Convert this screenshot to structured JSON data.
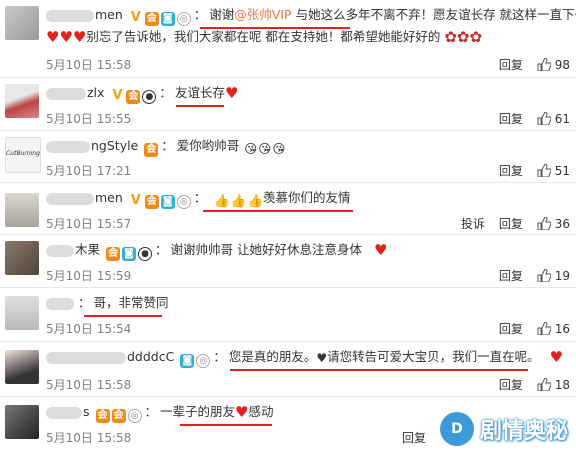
{
  "comments": [
    {
      "user": "men",
      "parts": [
        "谢谢",
        "@张帅VIP",
        " 与她这么多年不离不弃！愿友谊长存 就这样一直下去"
      ],
      "line2": "别忘了告诉她，我们大家都在呢 都在支持她！都希望她能好好的",
      "date": "5月10日 15:58",
      "reply": "回复",
      "likes": "98"
    },
    {
      "user": "zlx",
      "text": "友谊长存",
      "date": "5月10日 15:55",
      "reply": "回复",
      "likes": "61"
    },
    {
      "user": "ngStyle",
      "text": "爱你哟帅哥",
      "date": "5月10日 17:21",
      "reply": "回复",
      "likes": "51"
    },
    {
      "user": "men",
      "text": "羡慕你们的友情",
      "date": "5月10日 15:57",
      "report": "投诉",
      "reply": "回复",
      "likes": "36"
    },
    {
      "user": "木果",
      "text": "谢谢帅帅哥   让她好好休息注意身体",
      "date": "5月10日 15:59",
      "reply": "回复",
      "likes": "19"
    },
    {
      "user": "",
      "text": "哥，非常赞同",
      "date": "5月10日 15:54",
      "reply": "回复",
      "likes": "16"
    },
    {
      "user": "ddddcC",
      "text": "您是真的朋友。",
      "text2": "请您转告可爱大宝贝，我们一直在呢。",
      "date": "5月10日 15:58",
      "reply": "回复",
      "likes": "18"
    },
    {
      "user": "s",
      "text": "一辈子的朋友",
      "text2": "感动",
      "date": "5月10日 15:58",
      "reply": "回复"
    }
  ],
  "watermark": {
    "text": "剧情奥秘",
    "logo": "D"
  },
  "colors": {
    "underline": "#e0241c",
    "link": "#eb7350",
    "meta": "#808080",
    "separator": "#e9e9e9"
  },
  "avatar_labels": {
    "c3": "CutBurning"
  }
}
